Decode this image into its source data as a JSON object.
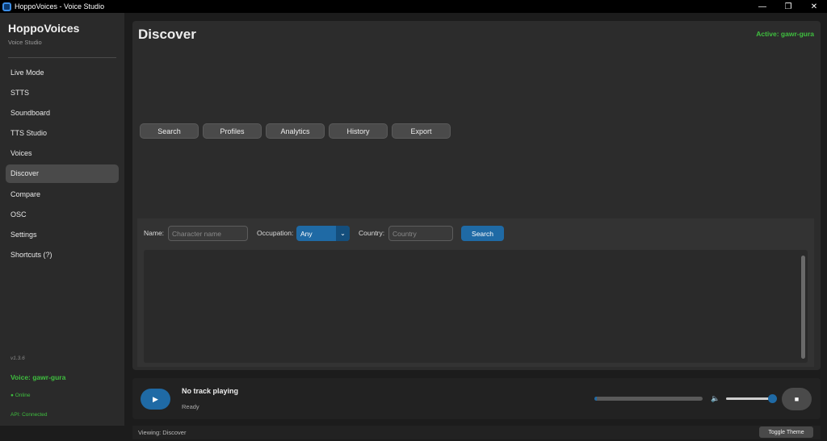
{
  "window": {
    "title": "HoppoVoices - Voice Studio",
    "minimize": "—",
    "restore": "❐",
    "close": "✕"
  },
  "sidebar": {
    "brand": "HoppoVoices",
    "subtitle": "Voice Studio",
    "items": [
      {
        "label": "Live Mode"
      },
      {
        "label": "STTS"
      },
      {
        "label": "Soundboard"
      },
      {
        "label": "TTS Studio"
      },
      {
        "label": "Voices"
      },
      {
        "label": "Discover",
        "active": true
      },
      {
        "label": "Compare"
      },
      {
        "label": "OSC"
      },
      {
        "label": "Settings"
      },
      {
        "label": "Shortcuts (?)"
      }
    ],
    "version": "v1.3.6",
    "voice": "Voice: gawr-gura",
    "online": "● Online",
    "api": "API: Connected"
  },
  "main": {
    "title": "Discover",
    "active_voice": "Active: gawr-gura",
    "tabs": [
      "Search",
      "Profiles",
      "Analytics",
      "History",
      "Export"
    ],
    "search": {
      "name_label": "Name:",
      "name_placeholder": "Character name",
      "occupation_label": "Occupation:",
      "occupation_value": "Any",
      "country_label": "Country:",
      "country_placeholder": "Country",
      "search_button": "Search"
    }
  },
  "player": {
    "play_icon": "▶",
    "track": "No track playing",
    "status": "Ready",
    "progress": 0.02,
    "volume_icon": "🔈",
    "volume": 1.0,
    "stop_icon": "■"
  },
  "statusbar": {
    "viewing": "Viewing: Discover",
    "toggle_theme": "Toggle Theme"
  },
  "colors": {
    "accent": "#1f6aa5",
    "status_green": "#3fbf3f"
  }
}
